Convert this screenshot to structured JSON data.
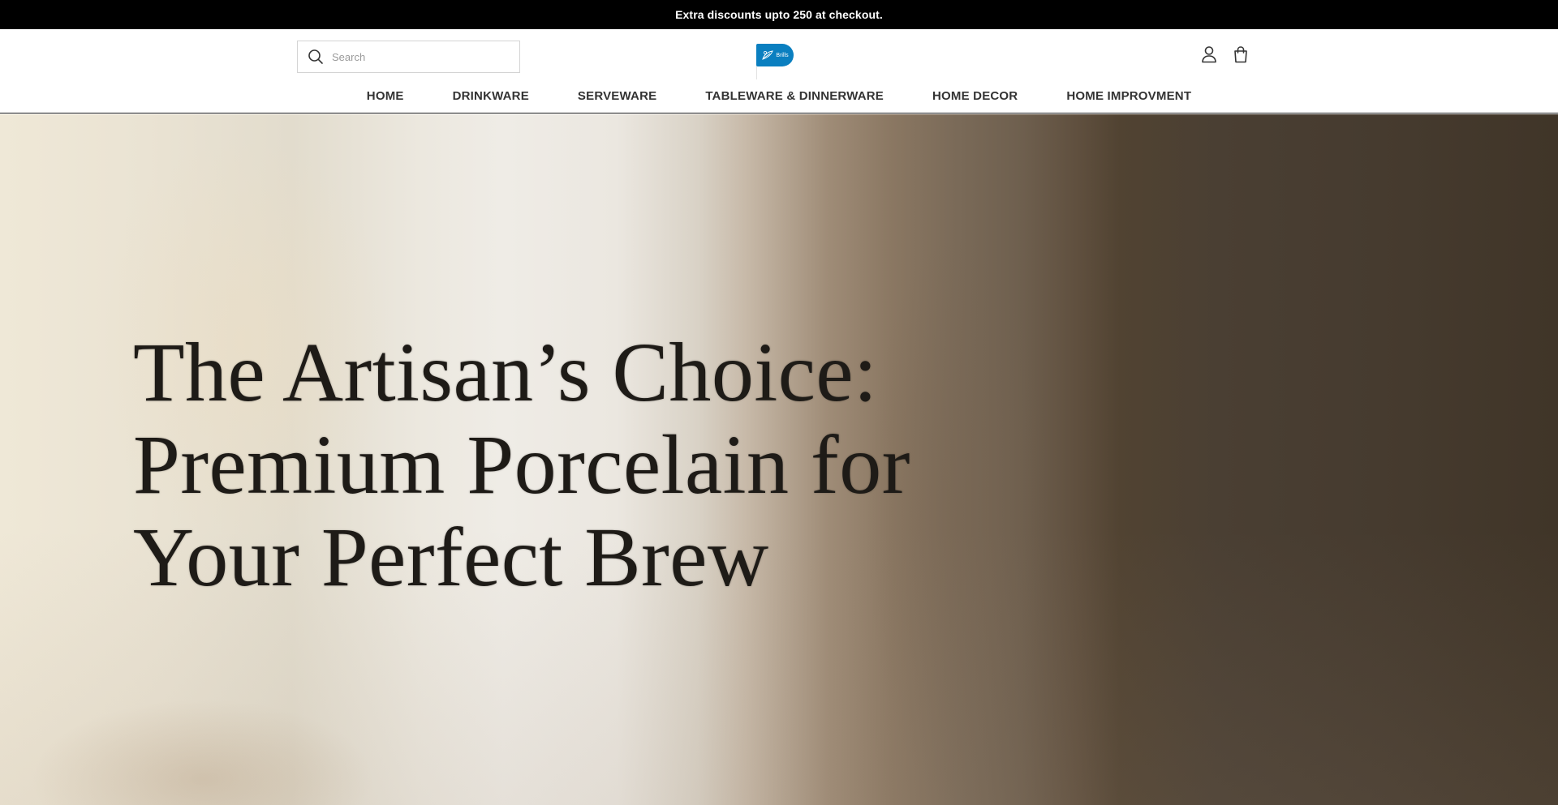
{
  "announcement": {
    "text": "Extra discounts upto 250 at checkout."
  },
  "header": {
    "search": {
      "placeholder": "Search",
      "value": ""
    },
    "logo": {
      "text": "Brills",
      "color": "#0a7fc0",
      "icon": "leaf-logo-icon"
    },
    "icons": {
      "account": "user-icon",
      "cart": "shopping-bag-icon"
    }
  },
  "nav": {
    "items": [
      "HOME",
      "DRINKWARE",
      "SERVEWARE",
      "TABLEWARE & DINNERWARE",
      "HOME DECOR",
      "HOME IMPROVMENT"
    ]
  },
  "hero": {
    "title_lines": [
      "The Artisan’s Choice:",
      "Premium Porcelain for",
      "Your Perfect Brew"
    ]
  }
}
